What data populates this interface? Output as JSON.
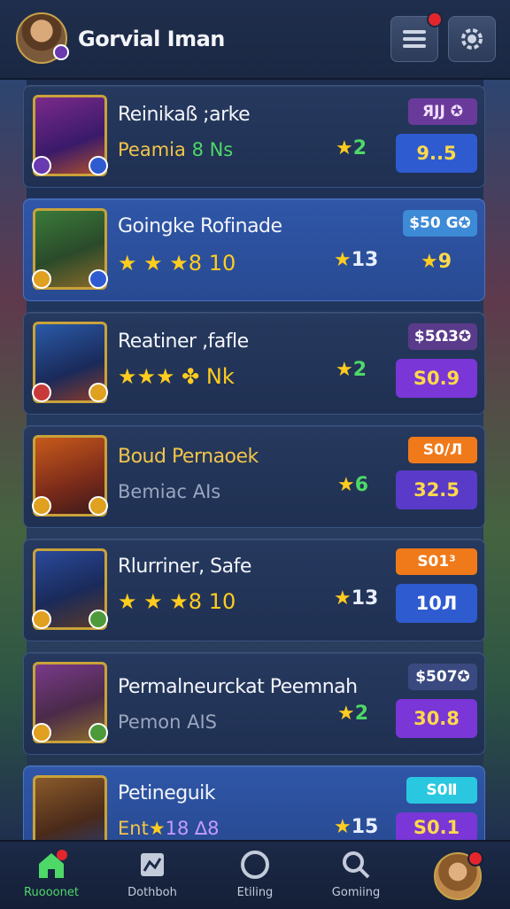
{
  "header": {
    "title": "Gorvial Iman"
  },
  "cards": [
    {
      "name": "Reinikaß ;arke",
      "sub": "Peamia ",
      "sub_green": "8 Ns",
      "stars": "",
      "rating": "2",
      "tag": "ꭱ9JJ ✪",
      "tag_display": "ЯЈЈ ✪",
      "value": "9..5"
    },
    {
      "name": "Goingke Rofinade",
      "sub": "",
      "sub_green": "",
      "stars": "★ ★ ★8 10",
      "rating": "13",
      "tag": "$50 G✪",
      "value": "9"
    },
    {
      "name": "Reatiner ,fafle",
      "sub": "",
      "sub_green": "",
      "stars": "★★★ ★ Nk",
      "rating": "2",
      "tag": "$5Ω3✪",
      "value": "S0.9"
    },
    {
      "name": "Boud Pernaoek",
      "sub": "Bemiac AIs",
      "sub_green": "",
      "stars": "",
      "rating": "6",
      "tag": "S0/Л",
      "value": "32.5"
    },
    {
      "name": "Rlurriner, Safe",
      "sub": "",
      "sub_green": "",
      "stars": "★ ★ ★8 10",
      "rating": "13",
      "tag": "S01³",
      "value": "10Л"
    },
    {
      "name": "Permalneurckat Peemnah",
      "sub": "Pemon AIS",
      "sub_green": "",
      "stars": "",
      "rating": "2",
      "tag": "$507✪",
      "value": "30.8"
    },
    {
      "name": "Petineguik",
      "sub": "Ent",
      "sub_green": "",
      "stars": "",
      "rating": "15",
      "tag": "S0Ⅱ",
      "value": "S0.1"
    }
  ],
  "tags_shown": [
    "ЯЈЈ✪",
    "$50 G✪",
    "$5Ω3✪",
    "S0/Л",
    "S01³",
    "$507✪",
    "S0Ⅱ"
  ],
  "card_texts": {
    "c0_name": "Reinikaß ;arke",
    "c0_sub": "Peamia",
    "c0_sub2": "8 Ns",
    "c0_rating": "2",
    "c0_tag": "ЯЈЈ ✪",
    "c0_value": "9..5",
    "c1_name": "Goingke Rofinade",
    "c1_stars": "★ ★ ★8 10",
    "c1_rating": "13",
    "c1_tag": "$50 G✪",
    "c1_value": "9",
    "c2_name": "Reatiner ,fafle",
    "c2_stars": "★★★ ✤ Nk",
    "c2_rating": "2",
    "c2_tag": "$5Ω3✪",
    "c2_value": "S0.9",
    "c3_name": "Boud Pernaoek",
    "c3_sub": "Bemiac AIs",
    "c3_rating": "6",
    "c3_tag": "S0/Л",
    "c3_value": "32.5",
    "c4_name": "Rlurriner, Safe",
    "c4_stars": "★ ★ ★8 10",
    "c4_rating": "13",
    "c4_tag": "S01³",
    "c4_value": "10Л",
    "c5_name": "Permalneurckat Peemnah",
    "c5_sub": "Pemon AIS",
    "c5_rating": "2",
    "c5_tag": "$507✪",
    "c5_value": "30.8",
    "c6_name": "Petineguik",
    "c6_sub": "Ent",
    "c6_sub2": "18 ∆8",
    "c6_rating": "15",
    "c6_tag": "S0Ⅱ",
    "c6_value": "S0.1"
  },
  "nav": {
    "home": "Ruooonet",
    "dashboard": "Dothboh",
    "rating": "Etiling",
    "search": "Gomiing"
  },
  "colors": {
    "accent_green": "#4ed868",
    "star_yellow": "#ffcc1f",
    "badge_red": "#e3262b",
    "pill_blue": "#2f5bd0",
    "pill_purple": "#7a36d6"
  }
}
